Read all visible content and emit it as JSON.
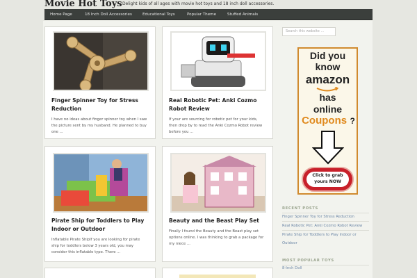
{
  "header": {
    "site_title": "Movie Hot Toys",
    "tagline": "Delight kids of all ages with movie hot toys and 18 inch doll accessories."
  },
  "nav": {
    "items": [
      {
        "label": "Home Page"
      },
      {
        "label": "18 Inch Doll Accessories"
      },
      {
        "label": "Educational Toys"
      },
      {
        "label": "Popular Theme"
      },
      {
        "label": "Stuffed Animals"
      }
    ]
  },
  "posts": [
    {
      "title_1": "Finger Spinner Toy for Stress",
      "title_2": "Reduction",
      "excerpt_1": "I have no ideas about finger spinner toy when I saw",
      "excerpt_2": "the picture sent by my husband. He planned to buy",
      "excerpt_3": "one ..."
    },
    {
      "title_1": "Real Robotic Pet: Anki Cozmo",
      "title_2": "Robot Review",
      "excerpt_1": "If your are sourcing for robotic pet for your kids,",
      "excerpt_2": "then drop by to read the Anki Cozmo Robot review",
      "excerpt_3": "before you ..."
    },
    {
      "title_1": "Pirate Ship for Toddlers to Play",
      "title_2": "Indoor or Outdoor",
      "excerpt_1": "Inflatable Pirate ShipIf you are looking for pirate",
      "excerpt_2": "ship for toddlers below 3 years old, you may",
      "excerpt_3": "consider this inflatable type. There ..."
    },
    {
      "title_1": "Beauty and the Beast Play Set",
      "title_2": "",
      "excerpt_1": "Finally I found the Beauty and the Beast play set",
      "excerpt_2": "options online. I was thinking to grab a package for",
      "excerpt_3": "my niece ..."
    }
  ],
  "sidebar": {
    "search_placeholder": "Search this website ...",
    "ad": {
      "line1": "Did you",
      "line2": "know",
      "brand": "amazon",
      "line4": "has",
      "line5": "online",
      "coupons": "Coupons",
      "question": "?",
      "cta_1": "Click to grab",
      "cta_2": "yours NOW"
    },
    "recent_title": "RECENT POSTS",
    "recent": [
      "Finger Spinner Toy for Stress Reduction",
      "Real Robotic Pet: Anki Cozmo Robot Review",
      "Pirate Ship for Toddlers to Play Indoor or",
      "Outdoor"
    ],
    "popular_title": "MOST POPULAR TOYS",
    "popular": [
      "8-Inch Doll"
    ]
  },
  "colors": {
    "nav_bg": "#3b3f3c",
    "link": "#6b86a6",
    "ad_border": "#d08a2e",
    "coupon": "#e08a1e",
    "cta": "#c8202a"
  }
}
